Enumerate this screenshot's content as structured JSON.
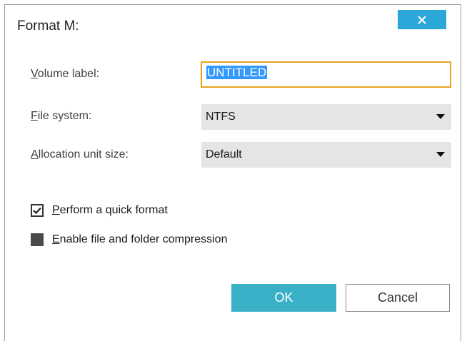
{
  "dialog": {
    "title": "Format M:",
    "close_icon": "close-icon"
  },
  "volume_label": {
    "label_first": "V",
    "label_rest": "olume label:",
    "value": "UNTITLED"
  },
  "file_system": {
    "label_first": "F",
    "label_rest": "ile system:",
    "selected": "NTFS"
  },
  "allocation_unit": {
    "label_first": "A",
    "label_rest": "llocation unit size:",
    "selected": "Default"
  },
  "quick_format": {
    "label_first": "P",
    "label_rest": "erform a quick format",
    "checked": true
  },
  "compression": {
    "label_first": "E",
    "label_rest": "nable file and folder compression",
    "checked": false
  },
  "buttons": {
    "ok": "OK",
    "cancel": "Cancel"
  },
  "colors": {
    "accent": "#2aa7d8",
    "ok_button": "#3ab0c6",
    "focus_border": "#e8a21c",
    "selection": "#3399ff"
  }
}
